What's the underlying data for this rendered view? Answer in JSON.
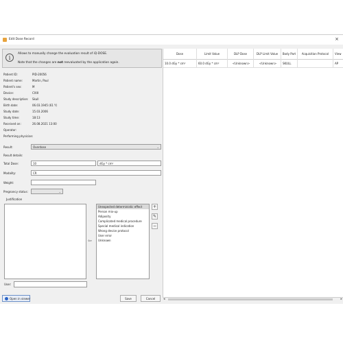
{
  "window": {
    "title": "Edit Dose Record",
    "close_glyph": "×"
  },
  "info": {
    "icon_glyph": "i",
    "line1": "Allows to manually change the evaluation result of iQ-DOSE.",
    "line2_prefix": "Note that the changes are ",
    "line2_bold": "not",
    "line2_suffix": " reevaluated by the application again."
  },
  "patient": [
    {
      "label": "Patient ID:",
      "value": "PID-20056"
    },
    {
      "label": "Patient name:",
      "value": "Martin, Paul"
    },
    {
      "label": "Patient's sex:",
      "value": "M"
    },
    {
      "label": "Device:",
      "value": "CXIII"
    },
    {
      "label": "Study description:",
      "value": "Skull"
    },
    {
      "label": "Birth date:",
      "value": "06.03.1945 (61 Y)"
    },
    {
      "label": "Study date:",
      "value": "15.03.2006"
    },
    {
      "label": "Study time:",
      "value": "18:13"
    },
    {
      "label": "Received on:",
      "value": "26.08.2021 13:00"
    },
    {
      "label": "Operator:",
      "value": ""
    },
    {
      "label": "Performing physician:",
      "value": ""
    }
  ],
  "form": {
    "result_label": "Result:",
    "result_value": "Overdose",
    "result_details_label": "Result details:",
    "total_dose_label": "Total Dose:",
    "total_dose_value": "10",
    "total_dose_unit": "dGy * cm²",
    "modality_label": "Modality:",
    "modality_value": "CR",
    "weight_label": "Weight:",
    "weight_value": "",
    "pregnancy_label": "Pregnancy status:",
    "pregnancy_value": "",
    "justification_label": "Justification",
    "combo_arrow": "⌄"
  },
  "reasons": [
    "Unexpected deterministic effect",
    "Person mix-up",
    "Adiposity",
    "Complicated medical procedure",
    "Special medical indication",
    "Wrong device protocol",
    "User error",
    "Unknown"
  ],
  "reason_selected_index": 0,
  "side_buttons": {
    "add": "+",
    "edit": "✎",
    "remove": "−"
  },
  "transfer_arrow": "⇦",
  "user": {
    "label": "User:",
    "value": ""
  },
  "buttons": {
    "open_viewer": "Open in viewer",
    "save": "Save",
    "cancel": "Cancel"
  },
  "grid": {
    "columns": [
      "Dose",
      "Limit Value",
      "DLP Dose",
      "DLP Limit Value",
      "Body Part",
      "Acquisition Protocol",
      "View"
    ],
    "rows": [
      [
        "10.0 dGy * cm²",
        "60.0 dGy * cm²",
        "<Unknown>",
        "<Unknown>",
        "SKULL",
        "",
        "AP"
      ]
    ]
  },
  "scroll": {
    "left": "◂",
    "right": "▸"
  }
}
